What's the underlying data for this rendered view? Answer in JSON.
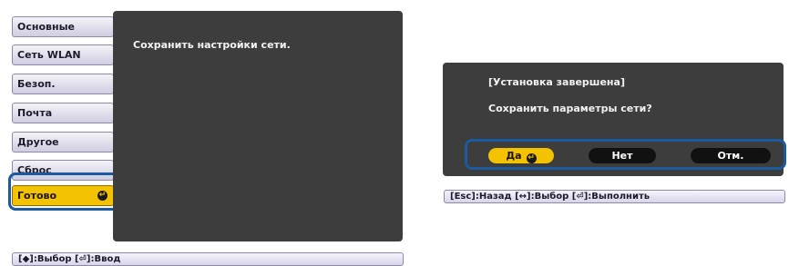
{
  "menu": {
    "items": [
      {
        "label": "Основные"
      },
      {
        "label": "Сеть WLAN"
      },
      {
        "label": "Безоп."
      },
      {
        "label": "Почта"
      },
      {
        "label": "Другое"
      },
      {
        "label": "Сброс"
      },
      {
        "label": "Готово",
        "selected": true,
        "icon": "enter-icon"
      }
    ]
  },
  "left_panel": {
    "text": "Сохранить настройки сети."
  },
  "left_hint": {
    "text": "[◆]:Выбор [⏎]:Ввод"
  },
  "dialog": {
    "title": "[Установка завершена]",
    "question": "Сохранить параметры сети?",
    "buttons": {
      "yes": "Да",
      "no": "Нет",
      "cancel": "Отм."
    }
  },
  "right_hint": {
    "text": "[Esc]:Назад [↔]:Выбор [⏎]:Выполнить"
  },
  "colors": {
    "accent": "#f3c200",
    "panel": "#3d3d3d",
    "highlight": "#1b5a9e"
  }
}
